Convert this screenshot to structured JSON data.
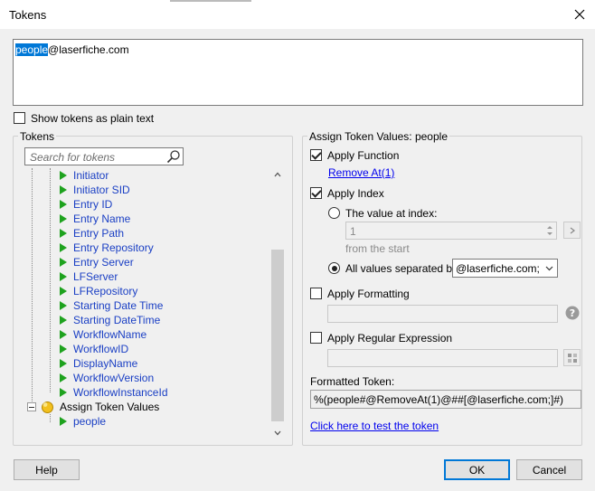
{
  "window": {
    "title": "Tokens"
  },
  "editor": {
    "selected_text": "people",
    "rest_text": "@laserfiche.com"
  },
  "show_plain": {
    "label": "Show tokens as plain text"
  },
  "tokens_panel": {
    "legend": "Tokens",
    "search_placeholder": "Search for tokens",
    "items": [
      "Initiator",
      "Initiator SID",
      "Entry ID",
      "Entry Name",
      "Entry Path",
      "Entry Repository",
      "Entry Server",
      "LFServer",
      "LFRepository",
      "Starting Date Time",
      "Starting DateTime",
      "WorkflowName",
      "WorkflowID",
      "DisplayName",
      "WorkflowVersion",
      "WorkflowInstanceId"
    ],
    "assign_label": "Assign Token Values",
    "child_item": "people"
  },
  "assign_panel": {
    "legend": "Assign Token Values: people",
    "apply_function": "Apply Function",
    "function_link": "Remove At(1)",
    "apply_index": "Apply Index",
    "value_at_index": "The value at index:",
    "index_value": "1",
    "from_start": "from the  start",
    "all_values": "All values separated by:",
    "separator": "@laserfiche.com;",
    "apply_formatting": "Apply Formatting",
    "apply_regex": "Apply Regular Expression",
    "formatted_label": "Formatted Token:",
    "formatted_value": "%(people#@RemoveAt(1)@##[@laserfiche.com;]#)",
    "test_link": "Click here to test the token"
  },
  "buttons": {
    "help": "Help",
    "ok": "OK",
    "cancel": "Cancel"
  },
  "colors": {
    "accent": "#0078d7",
    "token_text": "#1a3fc4",
    "token_icon": "#1ea21e",
    "link": "#0000ee"
  }
}
